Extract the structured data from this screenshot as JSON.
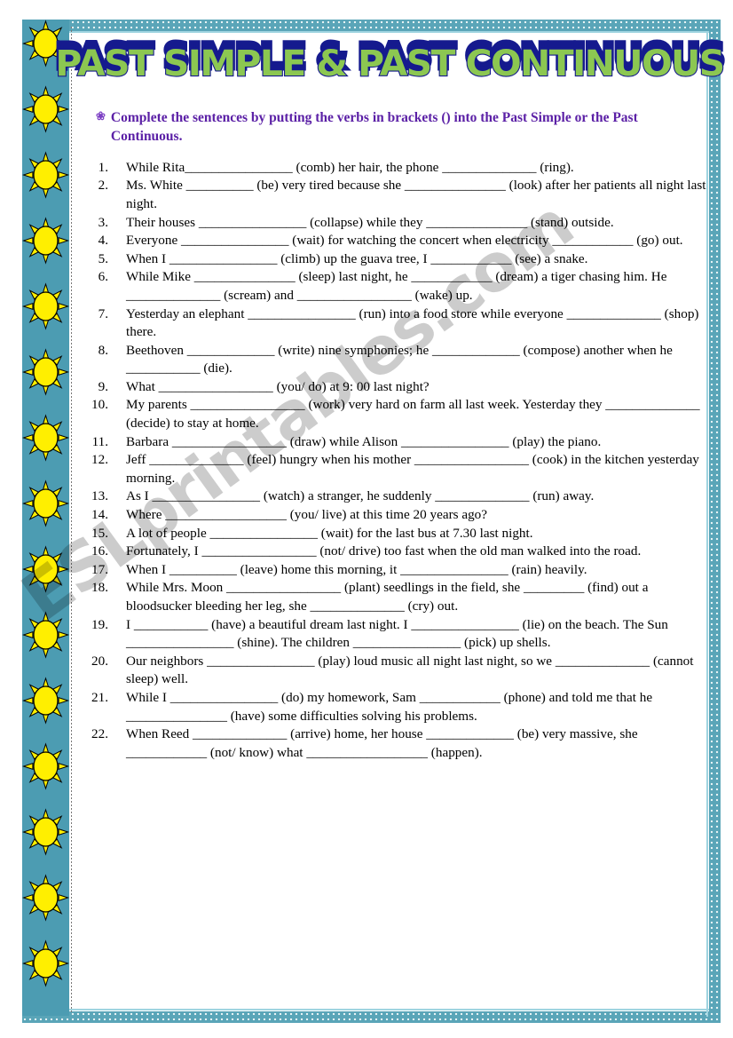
{
  "title": {
    "text": "PAST SIMPLE & PAST CONTINUOUS",
    "fill_color": "#8cc751",
    "shadow_color": "#151a8e"
  },
  "instruction": {
    "bullet_icon": "flower-bullet-icon",
    "bullet_glyph": "❀",
    "text": "Complete the sentences by putting the verbs in brackets () into the Past Simple or the Past Continuous.",
    "color": "#5b20a6"
  },
  "watermark": {
    "text": "ESLprintables.com"
  },
  "border": {
    "frame_color": "#5aa5b8",
    "inner_line_color": "#9fd4e0",
    "sun_column_color": "#4c9cb2",
    "sun_fill": "#ffef00",
    "sun_outline": "#000000",
    "sun_count": 15
  },
  "exercises": [
    {
      "num": "1.",
      "text": "While Rita________________ (comb) her hair, the phone ______________ (ring)."
    },
    {
      "num": "2.",
      "text": " Ms. White __________ (be) very tired because she _______________ (look) after her patients all night last night."
    },
    {
      "num": "3.",
      "text": "Their houses ________________ (collapse) while they _______________ (stand) outside."
    },
    {
      "num": "4.",
      "text": "Everyone ________________ (wait) for watching the concert when electricity ____________ (go) out."
    },
    {
      "num": "5.",
      "text": "When I ________________ (climb) up the guava tree, I ____________ (see) a snake."
    },
    {
      "num": "6.",
      "text": "While Mike _______________ (sleep) last night, he ____________ (dream) a tiger chasing him. He ______________ (scream) and _________________ (wake) up."
    },
    {
      "num": "7.",
      "text": "Yesterday an elephant ________________ (run) into a food store while everyone ______________ (shop) there."
    },
    {
      "num": "8.",
      "text": "Beethoven _____________ (write) nine symphonies; he _____________ (compose) another when he ___________ (die)."
    },
    {
      "num": "9.",
      "text": "What _________________ (you/ do) at 9: 00 last night?"
    },
    {
      "num": "10.",
      "text": "My parents _________________ (work) very hard on farm all last week. Yesterday they ______________ (decide) to stay at home."
    },
    {
      "num": "11.",
      "text": "Barbara _________________ (draw) while Alison ________________ (play) the piano."
    },
    {
      "num": "12.",
      "text": "Jeff ______________ (feel) hungry when his mother _________________ (cook) in the kitchen yesterday morning."
    },
    {
      "num": "13.",
      "text": "As I ________________ (watch) a stranger, he suddenly ______________ (run) away."
    },
    {
      "num": "14.",
      "text": "Where __________________ (you/ live) at this time 20 years ago?"
    },
    {
      "num": "15.",
      "text": " A lot of people ________________ (wait) for the last bus at 7.30 last night."
    },
    {
      "num": "16.",
      "text": "Fortunately, I _________________ (not/ drive) too fast when the old man walked into the road."
    },
    {
      "num": "17.",
      "text": "When I __________ (leave) home this morning, it ________________ (rain) heavily."
    },
    {
      "num": "18.",
      "text": "While Mrs. Moon _________________ (plant) seedlings in the field, she _________ (find) out a bloodsucker bleeding her leg, she ______________ (cry) out."
    },
    {
      "num": "19.",
      "text": "I ___________ (have) a beautiful dream last night. I ________________ (lie) on the beach. The Sun ________________ (shine). The children ________________ (pick) up shells."
    },
    {
      "num": "20.",
      "text": "Our neighbors ________________ (play) loud music all night last night, so we ______________ (cannot sleep) well."
    },
    {
      "num": "21.",
      "text": "While I ________________ (do) my homework, Sam ____________ (phone) and told me that he _______________ (have) some difficulties solving his problems."
    },
    {
      "num": "22.",
      "text": "When Reed ______________ (arrive) home, her house _____________ (be) very massive, she ____________ (not/ know) what __________________ (happen)."
    }
  ]
}
